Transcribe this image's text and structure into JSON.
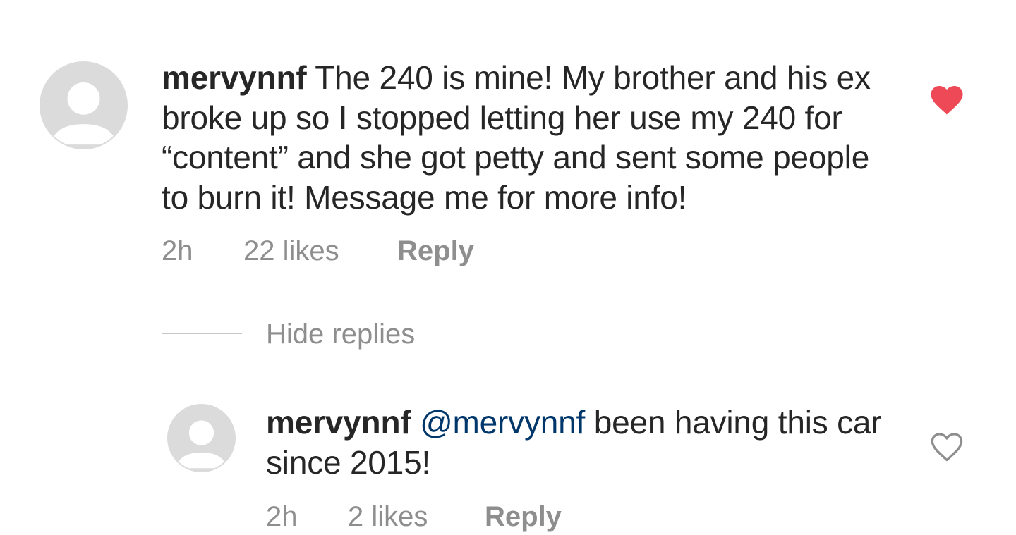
{
  "comments": [
    {
      "username": "mervynnf",
      "text": "The 240 is mine! My brother and his ex broke up so I stopped letting her use my 240 for “content” and she got petty and sent some people to burn it! Message me for more info!",
      "time": "2h",
      "likes": "22 likes",
      "reply_label": "Reply",
      "liked": true,
      "like_icon": "heart-filled-icon",
      "like_color": "#ed4956"
    }
  ],
  "hide_replies_label": "Hide replies",
  "replies": [
    {
      "username": "mervynnf",
      "mention": "@mervynnf",
      "text": "been having this car since 2015!",
      "time": "2h",
      "likes": "2 likes",
      "reply_label": "Reply",
      "liked": false,
      "like_icon": "heart-outline-icon",
      "like_color": "#8e8e8e"
    }
  ],
  "colors": {
    "text": "#262626",
    "meta": "#8e8e8e",
    "mention": "#00376b",
    "avatar_bg": "#dbdbdb",
    "like_active": "#ed4956"
  }
}
